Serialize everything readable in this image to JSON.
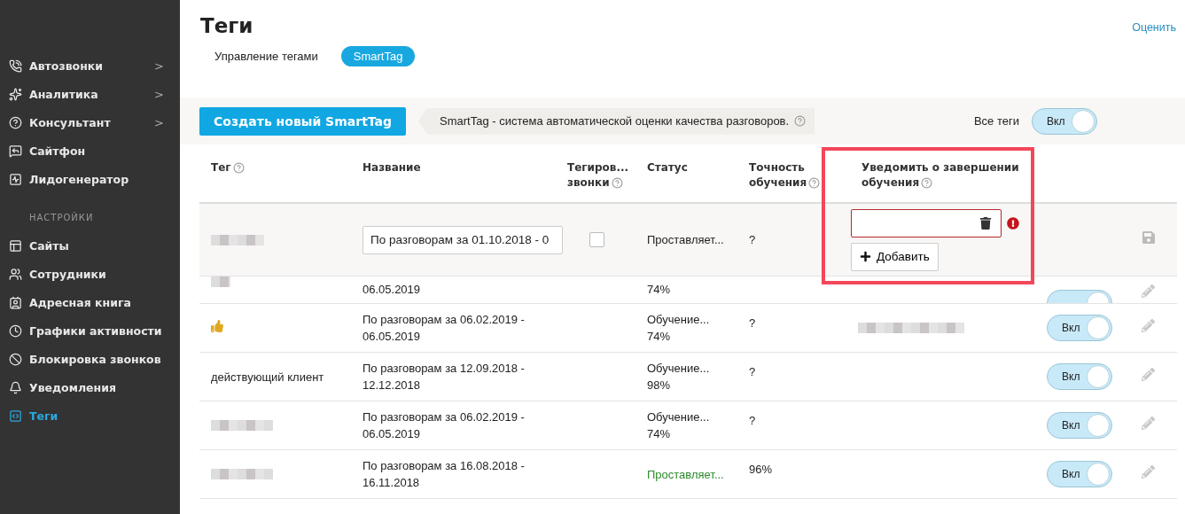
{
  "sidebar": {
    "items": [
      {
        "label": "Автозвонки",
        "arrow": ">",
        "selected": false
      },
      {
        "label": "Аналитика",
        "arrow": ">",
        "selected": false
      },
      {
        "label": "Консультант",
        "arrow": ">",
        "selected": false
      },
      {
        "label": "Сайтфон",
        "selected": false
      },
      {
        "label": "Лидогенератор",
        "selected": false
      },
      {
        "section": "НАСТРОЙКИ"
      },
      {
        "label": "Сайты",
        "selected": false
      },
      {
        "label": "Сотрудники",
        "selected": false
      },
      {
        "label": "Адресная книга",
        "selected": false
      },
      {
        "label": "Графики активности",
        "selected": false
      },
      {
        "label": "Блокировка звонков",
        "selected": false
      },
      {
        "label": "Уведомления",
        "selected": false
      },
      {
        "label": "Теги",
        "selected": true
      }
    ]
  },
  "page": {
    "title": "Теги",
    "rate_link": "Оценить",
    "subtabs": [
      {
        "label": "Управление тегами",
        "selected": false
      },
      {
        "label": "SmartTag",
        "selected": true
      }
    ]
  },
  "toolbar": {
    "create_button": "Создать новый SmartTag",
    "info": "SmartTag - система автоматической оценки качества разговоров.",
    "all_tags_label": "Все теги",
    "all_tags_toggle": {
      "label": "Вкл",
      "on": true
    }
  },
  "table": {
    "columns": [
      {
        "label": "Тег",
        "help": true
      },
      {
        "label": "Название",
        "help": false
      },
      {
        "label": "Тегиров...",
        "label2": "звонки",
        "help": true
      },
      {
        "label": "Статус",
        "help": false
      },
      {
        "label": "Точность",
        "label2": "обучения",
        "help": true
      },
      {
        "label": "Уведомить о завершении",
        "label2": "обучения",
        "help": true
      }
    ],
    "edit_row": {
      "name_value": "По разговорам за 01.10.2018 - 0",
      "tagging_checked": false,
      "status": "Проставляет...",
      "accuracy": "?",
      "email_error": true,
      "add_button": "Добавить"
    },
    "rows": [
      {
        "kind": "cut",
        "tag": {
          "kind": "blurred"
        },
        "name_lines": [
          "06.05.2019"
        ],
        "status_lines": [
          "74%"
        ],
        "status_ok": false,
        "accuracy": "",
        "notify_blurred": false,
        "toggle": {
          "on": true
        }
      },
      {
        "kind": "full",
        "tag": {
          "kind": "thumb"
        },
        "name_lines": [
          "По разговорам за 06.02.2019 -",
          "06.05.2019"
        ],
        "status_lines": [
          "Обучение...",
          "74%"
        ],
        "status_ok": false,
        "accuracy": "?",
        "notify_blurred": true,
        "toggle": {
          "label": "Вкл",
          "on": true
        }
      },
      {
        "kind": "full",
        "tag": {
          "kind": "text",
          "text": "действующий клиент"
        },
        "name_lines": [
          "По разговорам за 12.09.2018 -",
          "12.12.2018"
        ],
        "status_lines": [
          "Обучение...",
          "98%"
        ],
        "status_ok": false,
        "accuracy": "?",
        "notify_blurred": false,
        "toggle": {
          "label": "Вкл",
          "on": true
        }
      },
      {
        "kind": "full",
        "tag": {
          "kind": "blurred"
        },
        "name_lines": [
          "По разговорам за 06.02.2019 -",
          "06.05.2019"
        ],
        "status_lines": [
          "Обучение...",
          "74%"
        ],
        "status_ok": false,
        "accuracy": "?",
        "notify_blurred": false,
        "toggle": {
          "label": "Вкл",
          "on": true
        }
      },
      {
        "kind": "full",
        "tag": {
          "kind": "blurred"
        },
        "name_lines": [
          "По разговорам за 16.08.2018 -",
          "16.11.2018"
        ],
        "status_lines": [
          "Проставляет..."
        ],
        "status_ok": true,
        "accuracy": "96%",
        "notify_blurred": false,
        "toggle": {
          "label": "Вкл",
          "on": true
        }
      }
    ]
  },
  "annotation": {
    "shown": true
  }
}
